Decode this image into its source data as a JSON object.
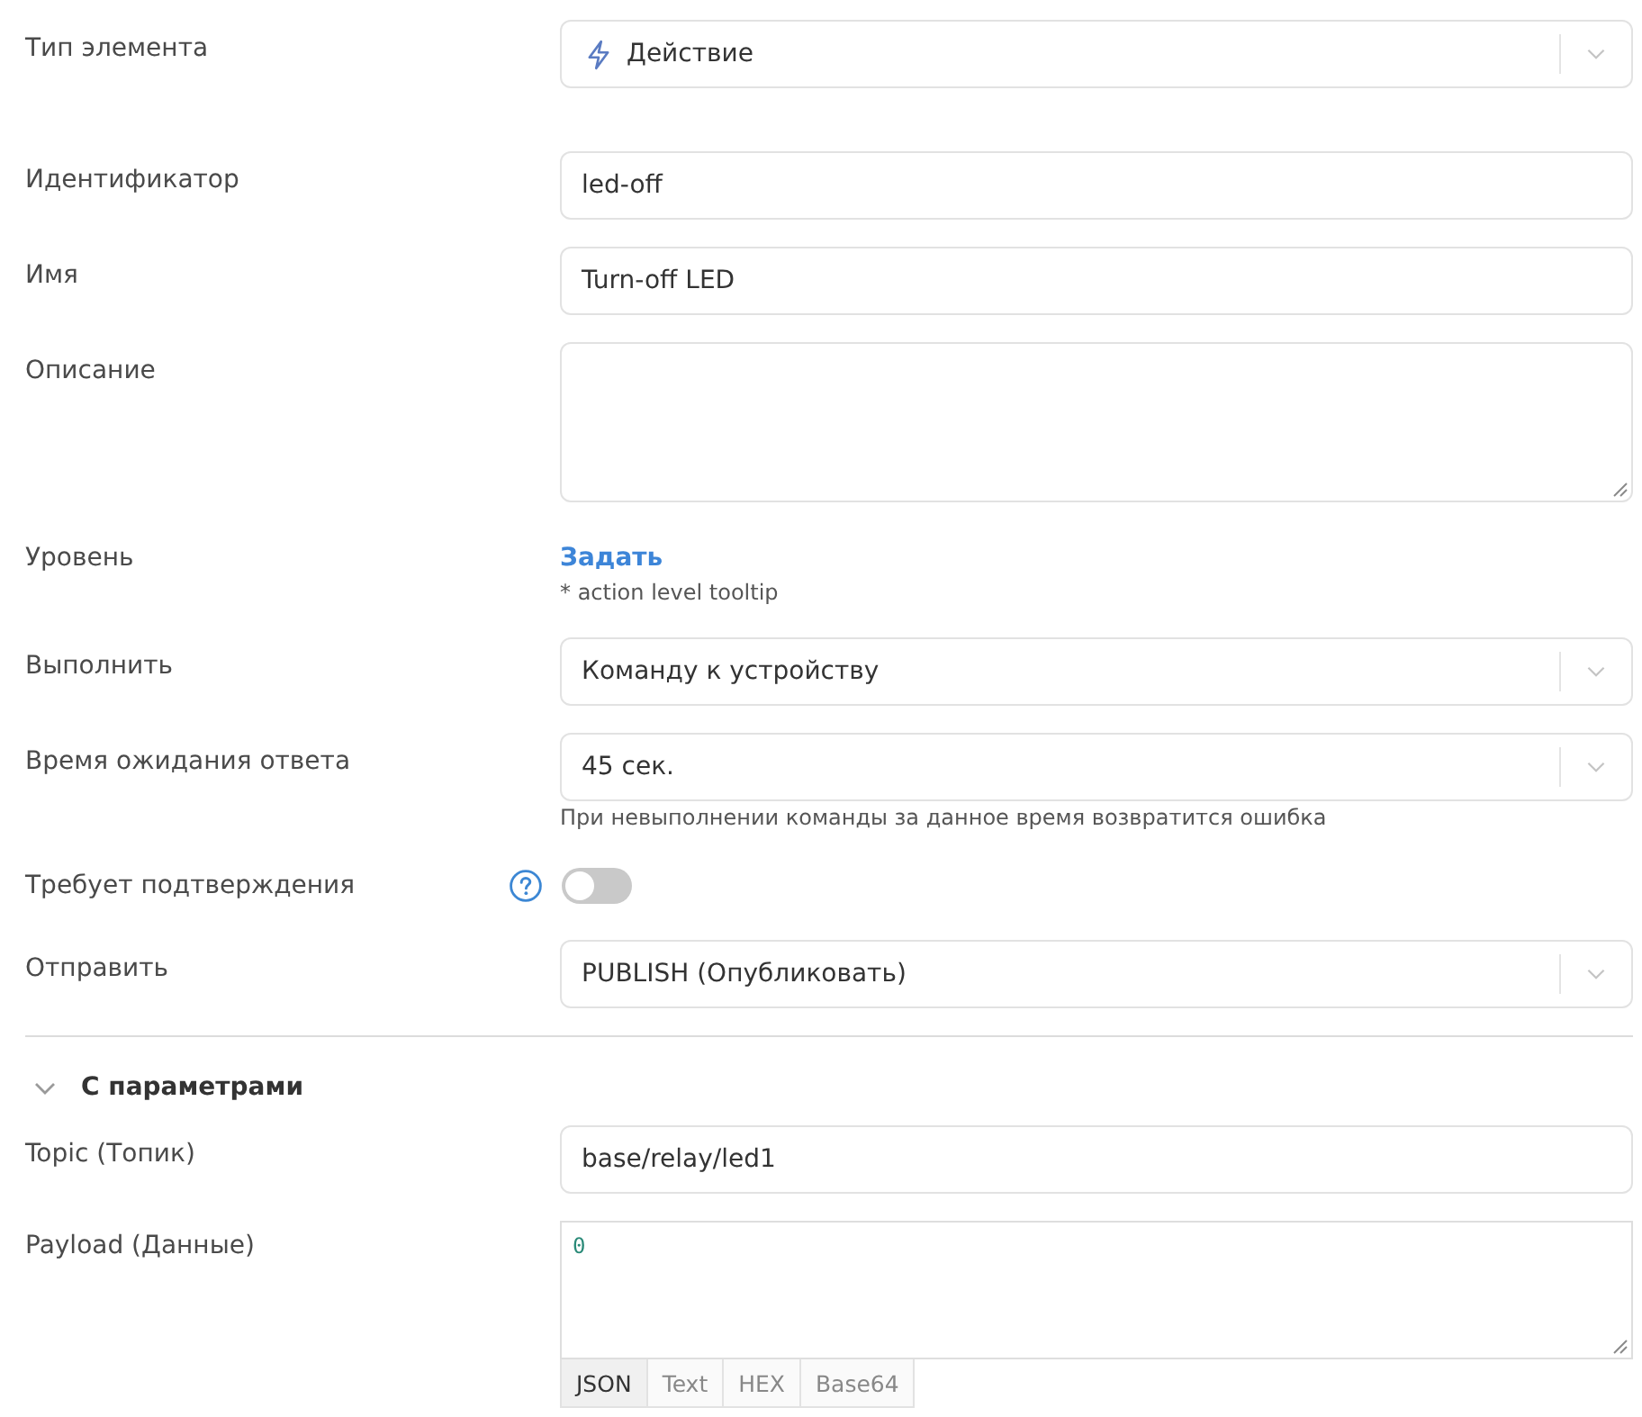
{
  "fields": [
    {
      "kind": "icon-select",
      "label": "Тип элемента",
      "value": "Действие"
    },
    {
      "kind": "input",
      "label": "Идентификатор",
      "value": "led-off"
    },
    {
      "kind": "input",
      "label": "Имя",
      "value": "Turn-off LED"
    },
    {
      "kind": "textarea",
      "label": "Описание"
    },
    {
      "kind": "link",
      "label": "Уровень",
      "link": "Задать",
      "hint": "* action level tooltip"
    },
    {
      "kind": "select",
      "label": "Выполнить",
      "value": "Команду к устройству"
    },
    {
      "kind": "select",
      "label": "Время ожидания ответа",
      "value": "45 сек.",
      "hint": "При невыполнении команды за данное время возвратится ошибка"
    },
    {
      "kind": "toggle",
      "label": "Требует подтверждения",
      "help": true,
      "on": false
    },
    {
      "kind": "select",
      "label": "Отправить",
      "value": "PUBLISH (Опубликовать)"
    }
  ],
  "section": {
    "title": "С параметрами",
    "expanded": true,
    "fields": [
      {
        "kind": "input",
        "label": "Topic (Топик)",
        "value": "base/relay/led1"
      },
      {
        "kind": "code",
        "label": "Payload (Данные)",
        "value": "0",
        "tabs": [
          {
            "label": "JSON",
            "selected": true
          },
          {
            "label": "Text",
            "selected": false
          },
          {
            "label": "HEX",
            "selected": false
          },
          {
            "label": "Base64",
            "selected": false
          }
        ]
      }
    ]
  }
}
